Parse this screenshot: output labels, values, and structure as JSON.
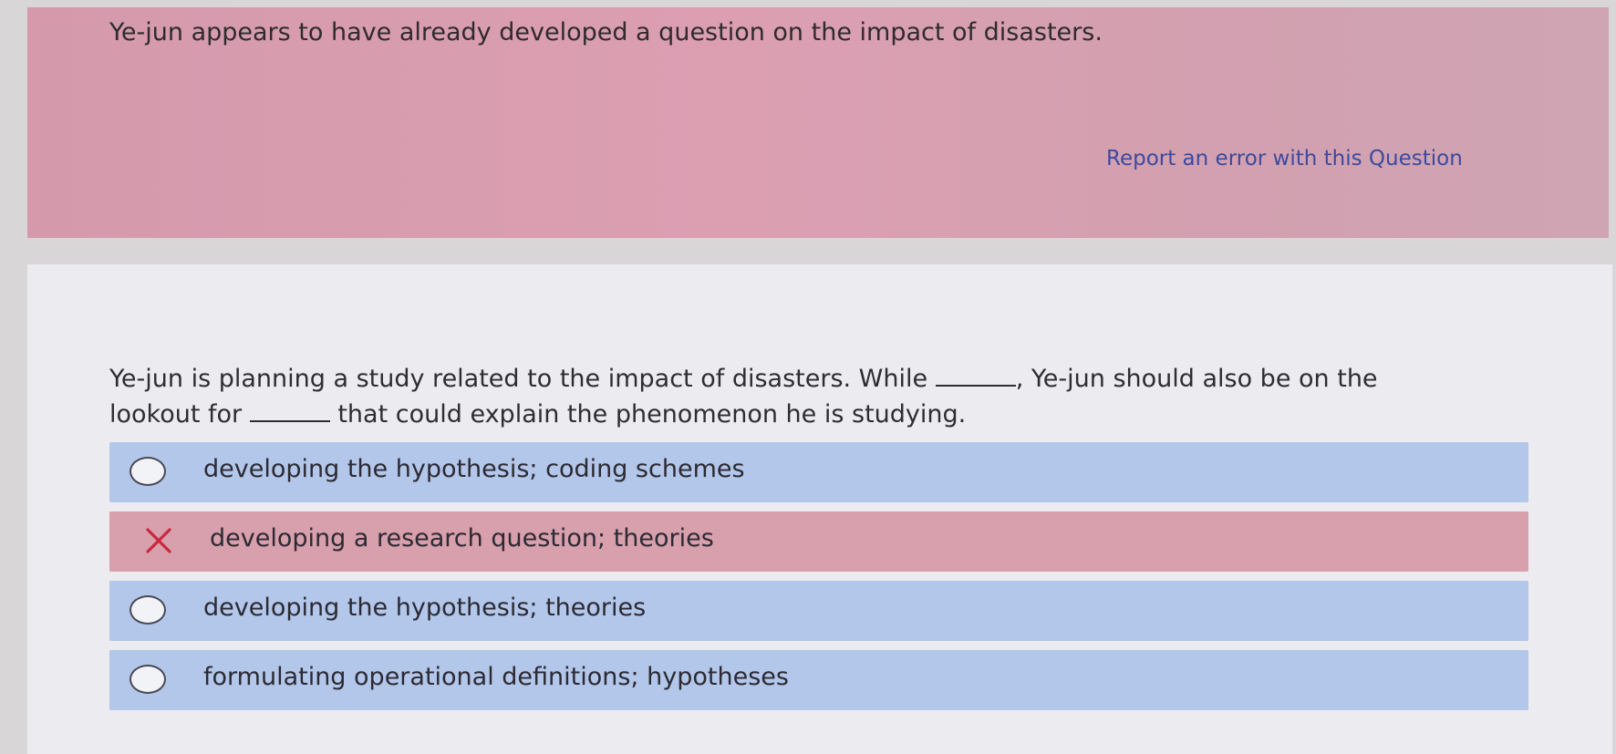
{
  "feedback": {
    "message": "Ye-jun appears to have already developed a question on the impact of disasters.",
    "report_link": "Report an error with this Question"
  },
  "question": {
    "part1": "Ye-jun is planning a study related to the impact of disasters. While",
    "part2": ", Ye-jun should also be on the lookout for",
    "part3": "that could explain the phenomenon he is studying."
  },
  "options": [
    {
      "label": "developing the hypothesis; coding schemes",
      "state": "unselected"
    },
    {
      "label": "developing a research question; theories",
      "state": "incorrect"
    },
    {
      "label": "developing the hypothesis; theories",
      "state": "unselected"
    },
    {
      "label": "formulating operational definitions; hypotheses",
      "state": "unselected"
    }
  ],
  "colors": {
    "feedback_bg": "#d89fb0",
    "option_bg": "#b3c7ea",
    "incorrect_bg": "#d89fac",
    "incorrect_mark": "#c9283f",
    "link": "#3b4aa0"
  },
  "icons": {
    "incorrect": "x-mark-icon",
    "radio": "radio-circle-icon"
  }
}
